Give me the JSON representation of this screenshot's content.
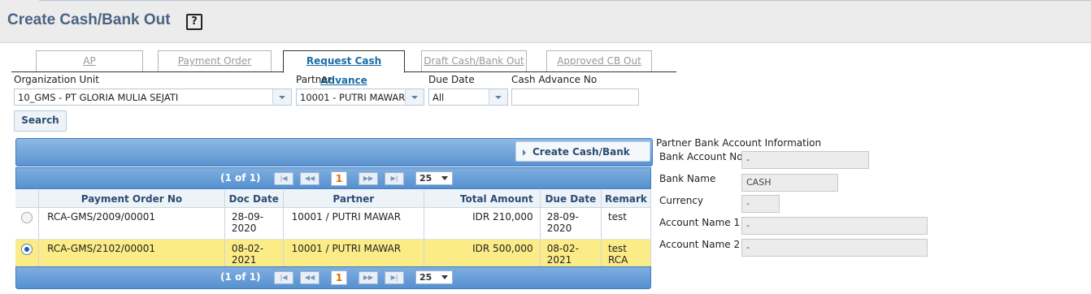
{
  "page": {
    "title": "Create Cash/Bank Out",
    "help_icon": "?"
  },
  "tabs": [
    {
      "label": "AP",
      "active": false
    },
    {
      "label": "Payment Order",
      "active": false
    },
    {
      "label": "Request Cash Advance",
      "active": true
    },
    {
      "label": "Draft Cash/Bank Out",
      "active": false
    },
    {
      "label": "Approved CB Out",
      "active": false
    }
  ],
  "filters": {
    "org_unit": {
      "label": "Organization Unit",
      "value": "10_GMS - PT GLORIA MULIA SEJATI"
    },
    "partner": {
      "label": "Partner",
      "value": "10001 - PUTRI MAWAR"
    },
    "due_date": {
      "label": "Due Date",
      "value": "All"
    },
    "cash_advance_no": {
      "label": "Cash Advance No",
      "value": ""
    },
    "search_label": "Search"
  },
  "toolbar": {
    "create_label": "Create Cash/Bank Out"
  },
  "pager": {
    "current": "(1 of 1)",
    "page": "1",
    "page_size": "25"
  },
  "grid": {
    "columns": [
      "Payment Order No",
      "Doc Date",
      "Partner",
      "Total Amount",
      "Due Date",
      "Remark"
    ],
    "rows": [
      {
        "selected": false,
        "payment_order_no": "RCA-GMS/2009/00001",
        "doc_date": "28-09-2020",
        "partner": "10001 / PUTRI MAWAR",
        "total_amount": "IDR 210,000",
        "due_date": "28-09-2020",
        "remark": "test"
      },
      {
        "selected": true,
        "payment_order_no": "RCA-GMS/2102/00001",
        "doc_date": "08-02-2021",
        "partner": "10001 / PUTRI MAWAR",
        "total_amount": "IDR 500,000",
        "due_date": "08-02-2021",
        "remark": "test RCA"
      }
    ]
  },
  "bank_info": {
    "title": "Partner Bank Account Information",
    "bank_account_no": {
      "label": "Bank Account No",
      "value": "-"
    },
    "bank_name": {
      "label": "Bank Name",
      "value": "CASH"
    },
    "currency": {
      "label": "Currency",
      "value": "-"
    },
    "account_name_1": {
      "label": "Account Name 1",
      "value": "-"
    },
    "account_name_2": {
      "label": "Account Name 2",
      "value": "-"
    }
  },
  "colors": {
    "title": "#4a6382",
    "accent": "#5690d0",
    "selected_row": "#fbec88",
    "active_tab": "#1a6ca8"
  }
}
